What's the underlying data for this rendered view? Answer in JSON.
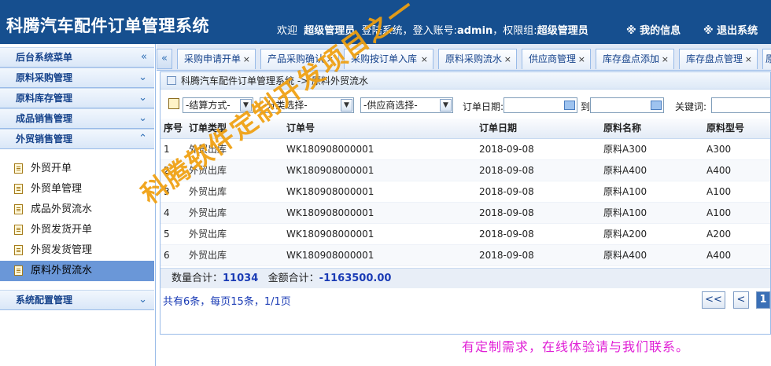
{
  "header": {
    "title": "科腾汽车配件订单管理系统",
    "welcome": "欢迎",
    "user_role": "超级管理员",
    "login_text": "登陆系统，登入账号:",
    "account": "admin",
    "group_text": "，权限组:",
    "group": "超级管理员",
    "my_info": "※ 我的信息",
    "logout": "※ 退出系统"
  },
  "sidebar": {
    "sections": [
      {
        "label": "后台系统菜单",
        "chevron": "«"
      },
      {
        "label": "原料采购管理",
        "chevron": "⌄"
      },
      {
        "label": "原料库存管理",
        "chevron": "⌄"
      },
      {
        "label": "成品销售管理",
        "chevron": "⌄"
      },
      {
        "label": "外贸销售管理",
        "chevron": "⌃"
      },
      {
        "label": "系统配置管理",
        "chevron": "⌄"
      }
    ],
    "items": [
      {
        "label": "外贸开单"
      },
      {
        "label": "外贸单管理"
      },
      {
        "label": "成品外贸流水"
      },
      {
        "label": "外贸发货开单"
      },
      {
        "label": "外贸发货管理"
      },
      {
        "label": "原料外贸流水"
      }
    ]
  },
  "tabs": {
    "collapse": "«",
    "items": [
      {
        "label": "采购申请开单"
      },
      {
        "label": "产品采购确认"
      },
      {
        "label": "采购按订单入库"
      },
      {
        "label": "原料采购流水"
      },
      {
        "label": "供应商管理"
      },
      {
        "label": "库存盘点添加"
      },
      {
        "label": "库存盘点管理"
      },
      {
        "label": "原"
      }
    ],
    "close": "×"
  },
  "breadcrumb": "科腾汽车配件订单管理系统 -> 原料外贸流水",
  "toolbar": {
    "settle": "-结算方式-",
    "category": "-分类选择-",
    "supplier": "-供应商选择-",
    "order_date_label": "订单日期:",
    "to_label": "到",
    "keyword_label": "关键词:"
  },
  "table": {
    "headers": [
      "序号",
      "订单类型",
      "订单号",
      "订单日期",
      "原料名称",
      "原料型号"
    ],
    "rows": [
      [
        "1",
        "外贸出库",
        "WK180908000001",
        "2018-09-08",
        "原料A300",
        "A300"
      ],
      [
        "2",
        "外贸出库",
        "WK180908000001",
        "2018-09-08",
        "原料A400",
        "A400"
      ],
      [
        "3",
        "外贸出库",
        "WK180908000001",
        "2018-09-08",
        "原料A100",
        "A100"
      ],
      [
        "4",
        "外贸出库",
        "WK180908000001",
        "2018-09-08",
        "原料A100",
        "A100"
      ],
      [
        "5",
        "外贸出库",
        "WK180908000001",
        "2018-09-08",
        "原料A200",
        "A200"
      ],
      [
        "6",
        "外贸出库",
        "WK180908000001",
        "2018-09-08",
        "原料A400",
        "A400"
      ]
    ]
  },
  "summary": {
    "qty_label": "数量合计：",
    "qty_value": "11034",
    "amount_label": "金额合计：",
    "amount_value": "-1163500.00"
  },
  "pager": {
    "text": "共有6条，每页15条，1/1页",
    "first": "<<",
    "prev": "<",
    "current": "1"
  },
  "contact": "有定制需求，在线体验请与我们联系。",
  "watermark": "科腾软件定制开发项目之一",
  "colors": {
    "header_bg": "#164f8f",
    "active_item": "#6a97d8",
    "accent_blue": "#1a3bb5",
    "watermark": "#f0a010",
    "contact": "#e020d6"
  }
}
